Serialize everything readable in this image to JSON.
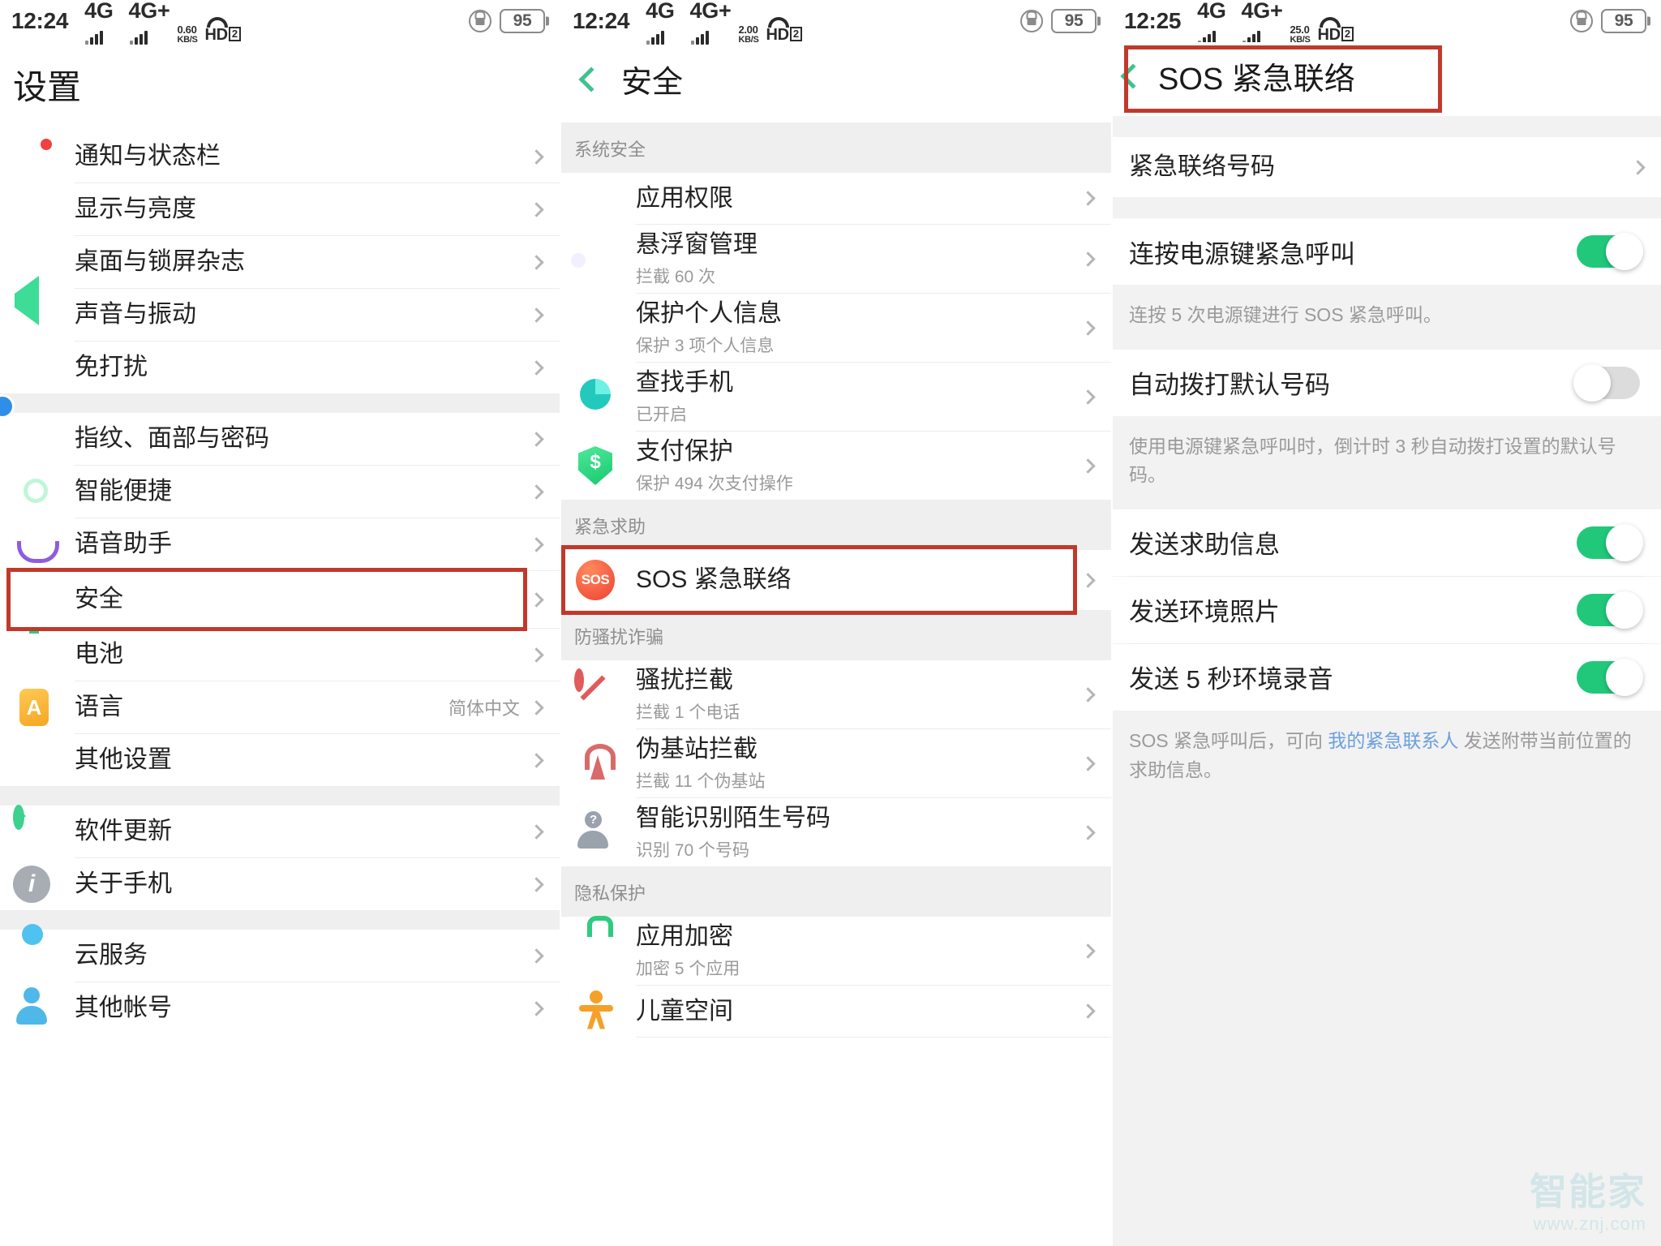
{
  "panels": [
    {
      "status": {
        "time": "12:24",
        "net1": "4G",
        "net2": "4G+",
        "speed": "0.60",
        "speed_unit": "KB/S",
        "hd": "HD",
        "sim": "2",
        "battery": "95"
      },
      "title": "设置",
      "groups": [
        {
          "rows": [
            {
              "icon": "notification-icon",
              "label": "通知与状态栏"
            },
            {
              "icon": "display-icon",
              "label": "显示与亮度"
            },
            {
              "icon": "wallpaper-icon",
              "label": "桌面与锁屏杂志"
            },
            {
              "icon": "sound-icon",
              "label": "声音与振动"
            },
            {
              "icon": "moon-icon",
              "label": "免打扰"
            }
          ]
        },
        {
          "rows": [
            {
              "icon": "fingerprint-icon",
              "label": "指纹、面部与密码"
            },
            {
              "icon": "brain-icon",
              "label": "智能便捷"
            },
            {
              "icon": "microphone-icon",
              "label": "语音助手"
            },
            {
              "icon": "shield-check-icon",
              "label": "安全",
              "highlighted": true
            },
            {
              "icon": "battery-icon",
              "label": "电池"
            },
            {
              "icon": "language-icon",
              "label": "语言",
              "value": "简体中文"
            },
            {
              "icon": "gear-icon",
              "label": "其他设置"
            }
          ]
        },
        {
          "rows": [
            {
              "icon": "software-update-icon",
              "label": "软件更新"
            },
            {
              "icon": "info-icon",
              "label": "关于手机"
            }
          ]
        },
        {
          "rows": [
            {
              "icon": "cloud-icon",
              "label": "云服务"
            },
            {
              "icon": "account-icon",
              "label": "其他帐号"
            }
          ]
        }
      ]
    },
    {
      "status": {
        "time": "12:24",
        "net1": "4G",
        "net2": "4G+",
        "speed": "2.00",
        "speed_unit": "KB/S",
        "hd": "HD",
        "sim": "2",
        "battery": "95"
      },
      "title": "安全",
      "back": "back-arrow",
      "groups": [
        {
          "header": "系统安全",
          "rows": [
            {
              "icon": "permissions-icon",
              "label": "应用权限"
            },
            {
              "icon": "floating-window-icon",
              "label": "悬浮窗管理",
              "sub": "拦截 60 次"
            },
            {
              "icon": "privacy-shield-icon",
              "label": "保护个人信息",
              "sub": "保护 3 项个人信息"
            },
            {
              "icon": "find-phone-icon",
              "label": "查找手机",
              "sub": "已开启"
            },
            {
              "icon": "payment-shield-icon",
              "label": "支付保护",
              "sub": "保护 494 次支付操作"
            }
          ]
        },
        {
          "header": "紧急求助",
          "rows": [
            {
              "icon": "sos-icon",
              "label": "SOS 紧急联络",
              "highlighted": true
            }
          ]
        },
        {
          "header": "防骚扰诈骗",
          "rows": [
            {
              "icon": "block-icon",
              "label": "骚扰拦截",
              "sub": "拦截 1 个电话"
            },
            {
              "icon": "fake-base-station-icon",
              "label": "伪基站拦截",
              "sub": "拦截 11 个伪基站"
            },
            {
              "icon": "unknown-number-icon",
              "label": "智能识别陌生号码",
              "sub": "识别 70 个号码"
            }
          ]
        },
        {
          "header": "隐私保护",
          "rows": [
            {
              "icon": "app-lock-icon",
              "label": "应用加密",
              "sub": "加密 5 个应用"
            },
            {
              "icon": "kids-space-icon",
              "label": "儿童空间"
            }
          ]
        }
      ]
    },
    {
      "status": {
        "time": "12:25",
        "net1": "4G",
        "net2": "4G+",
        "speed": "25.0",
        "speed_unit": "KB/S",
        "hd": "HD",
        "sim": "2",
        "battery": "95"
      },
      "title": "SOS 紧急联络",
      "back": "back-arrow",
      "title_highlighted": true,
      "nav_rows": [
        {
          "label": "紧急联络号码"
        }
      ],
      "toggle_rows": [
        {
          "label": "连按电源键紧急呼叫",
          "state": "on",
          "desc": "连按 5 次电源键进行 SOS 紧急呼叫。"
        },
        {
          "label": "自动拨打默认号码",
          "state": "off",
          "desc": "使用电源键紧急呼叫时，倒计时 3 秒自动拨打设置的默认号码。"
        },
        {
          "label": "发送求助信息",
          "state": "on"
        },
        {
          "label": "发送环境照片",
          "state": "on"
        },
        {
          "label": "发送 5 秒环境录音",
          "state": "on"
        }
      ],
      "footer": {
        "pre": "SOS 紧急呼叫后，可向 ",
        "link": "我的紧急联系人",
        "post": " 发送附带当前位置的求助信息。"
      }
    }
  ],
  "watermark": {
    "line1": "智能家",
    "line2": "www.znj.com"
  },
  "colors": {
    "accent_green": "#21c87a",
    "highlight_red": "#c0392b",
    "link_blue": "#6a9fe0"
  }
}
